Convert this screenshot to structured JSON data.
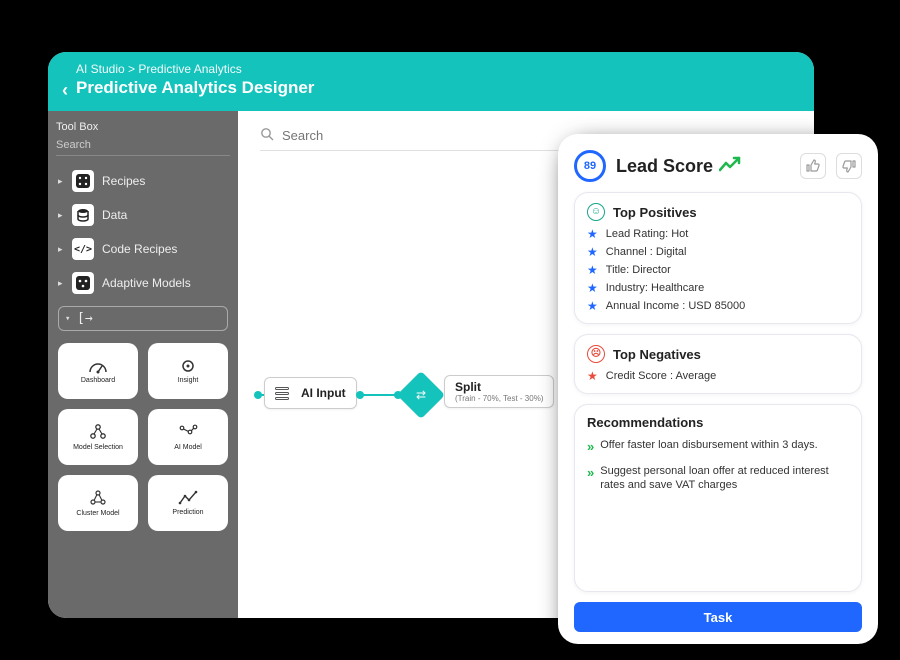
{
  "header": {
    "breadcrumb": "AI Studio > Predictive Analytics",
    "title": "Predictive Analytics Designer"
  },
  "sidebar": {
    "title": "Tool Box",
    "search_placeholder": "Search",
    "items": [
      {
        "label": "Recipes"
      },
      {
        "label": "Data"
      },
      {
        "label": "Code Recipes"
      },
      {
        "label": "Adaptive Models"
      }
    ],
    "expand_glyph": "[→",
    "tiles": [
      {
        "label": "Dashboard"
      },
      {
        "label": "Insight"
      },
      {
        "label": "Model Selection"
      },
      {
        "label": "AI Model"
      },
      {
        "label": "Cluster Model"
      },
      {
        "label": "Prediction"
      }
    ]
  },
  "canvas": {
    "search_placeholder": "Search",
    "nodes": {
      "ai_input": {
        "title": "AI Input"
      },
      "split": {
        "title": "Split",
        "subtitle": "(Train - 70%, Test - 30%)"
      }
    }
  },
  "lead": {
    "score": "89",
    "title": "Lead Score",
    "positives_title": "Top Positives",
    "negatives_title": "Top Negatives",
    "recommend_title": "Recommendations",
    "positives": [
      "Lead Rating: Hot",
      "Channel : Digital",
      "Title: Director",
      "Industry: Healthcare",
      "Annual Income : USD 85000"
    ],
    "negatives": [
      "Credit Score : Average"
    ],
    "recommendations": [
      "Offer faster loan disbursement within 3 days.",
      "Suggest personal loan offer at reduced interest rates and save VAT charges"
    ],
    "task_label": "Task"
  }
}
